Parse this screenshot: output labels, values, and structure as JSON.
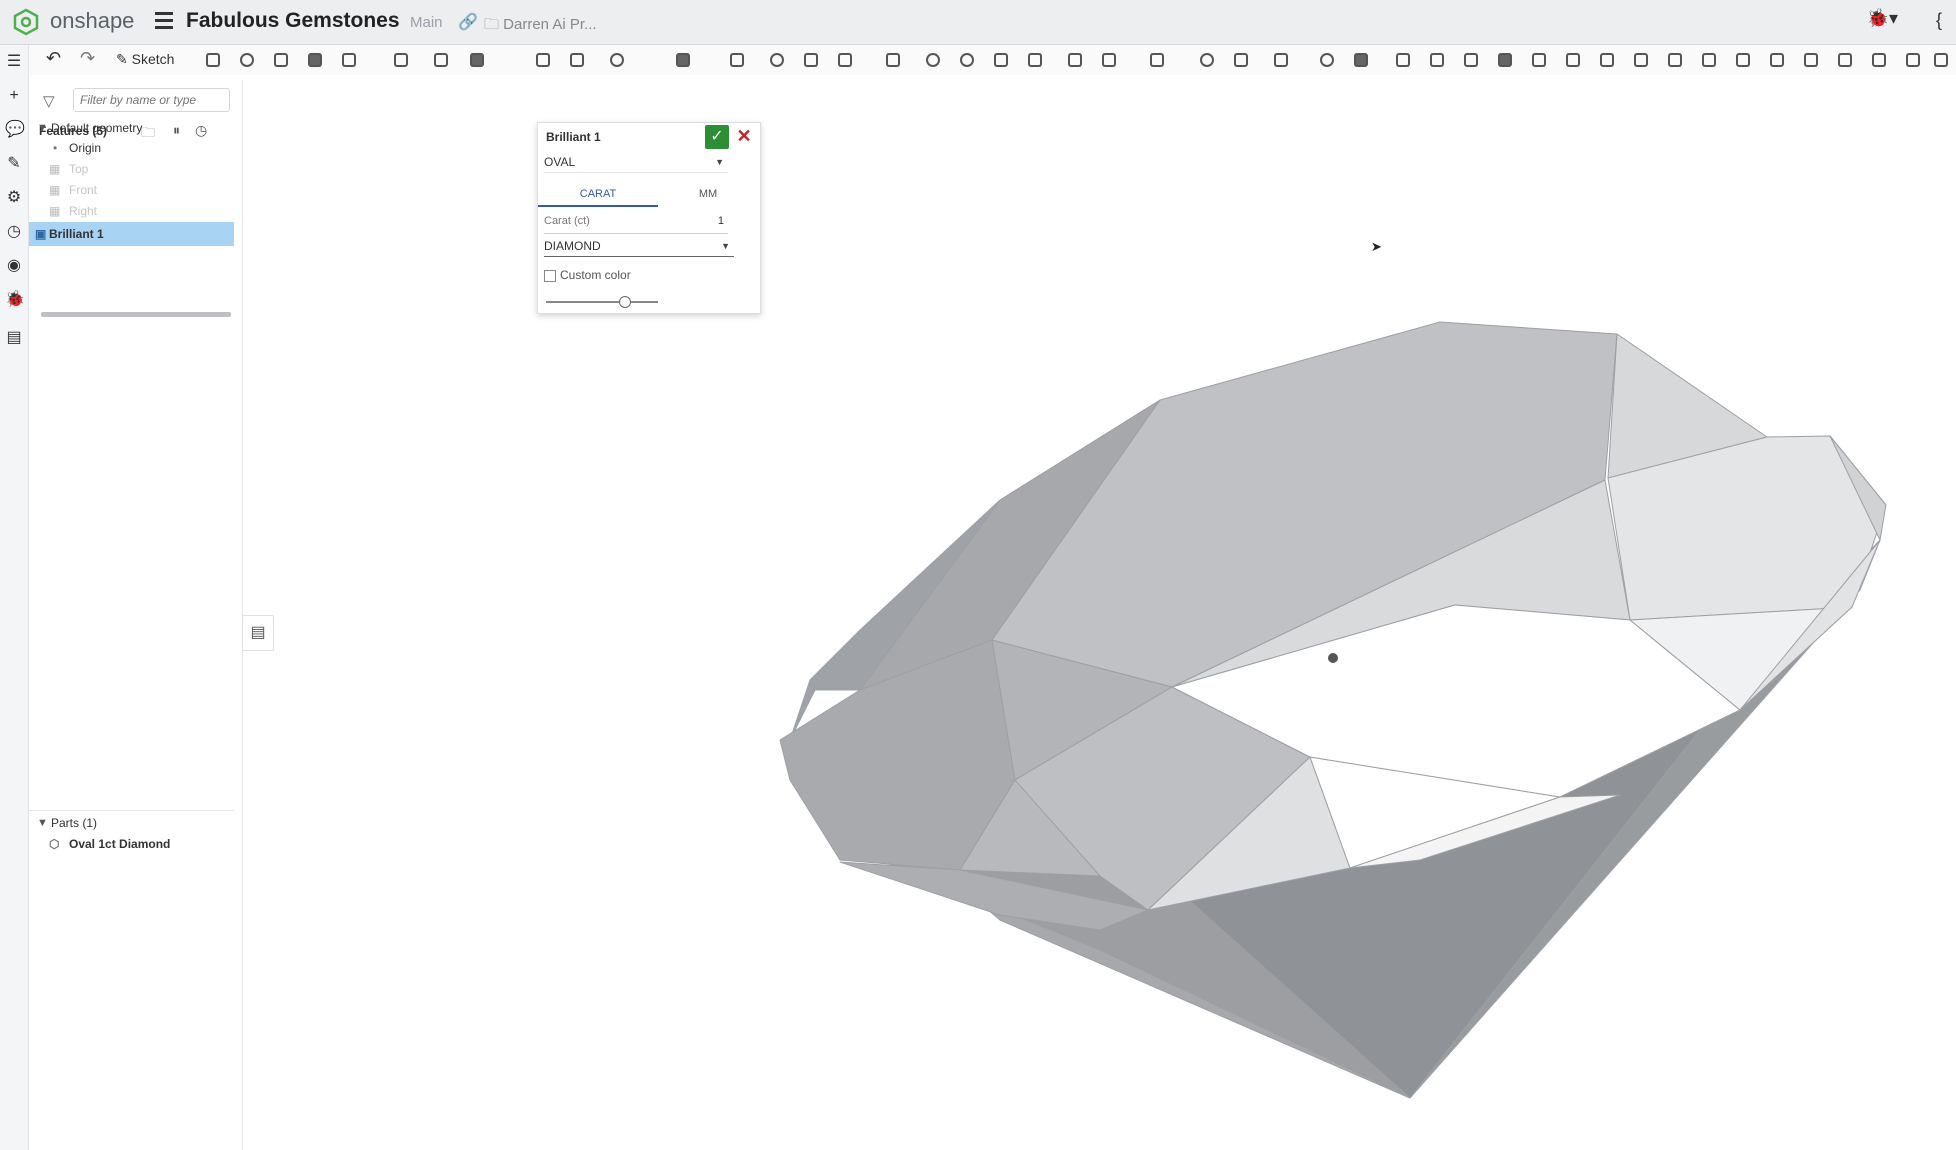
{
  "app": {
    "brand": "onshape",
    "document_title": "Fabulous Gemstones",
    "branch": "Main",
    "folder": "Darren Ai Pr..."
  },
  "toolbar": {
    "undo_icon": "↶",
    "redo_icon": "↷",
    "sketch_label": "Sketch"
  },
  "panel": {
    "filter_placeholder": "Filter by name or type",
    "features_header": "Features (5)",
    "default_geometry": "Default geometry",
    "origin": "Origin",
    "top": "Top",
    "front": "Front",
    "right": "Right",
    "brilliant": "Brilliant 1",
    "parts_header": "Parts (1)",
    "part_name": "Oval 1ct Diamond"
  },
  "dialog": {
    "title": "Brilliant 1",
    "shape": "OVAL",
    "tab_carat": "CARAT",
    "tab_mm": "MM",
    "carat_label": "Carat (ct)",
    "carat_value": "1",
    "material": "DIAMOND",
    "custom_color": "Custom color",
    "slider_level": 0.7
  },
  "colors": {
    "accent": "#375aa3",
    "ok": "#2d8f35",
    "cancel": "#c6202b",
    "selected": "#a9d3f2"
  }
}
